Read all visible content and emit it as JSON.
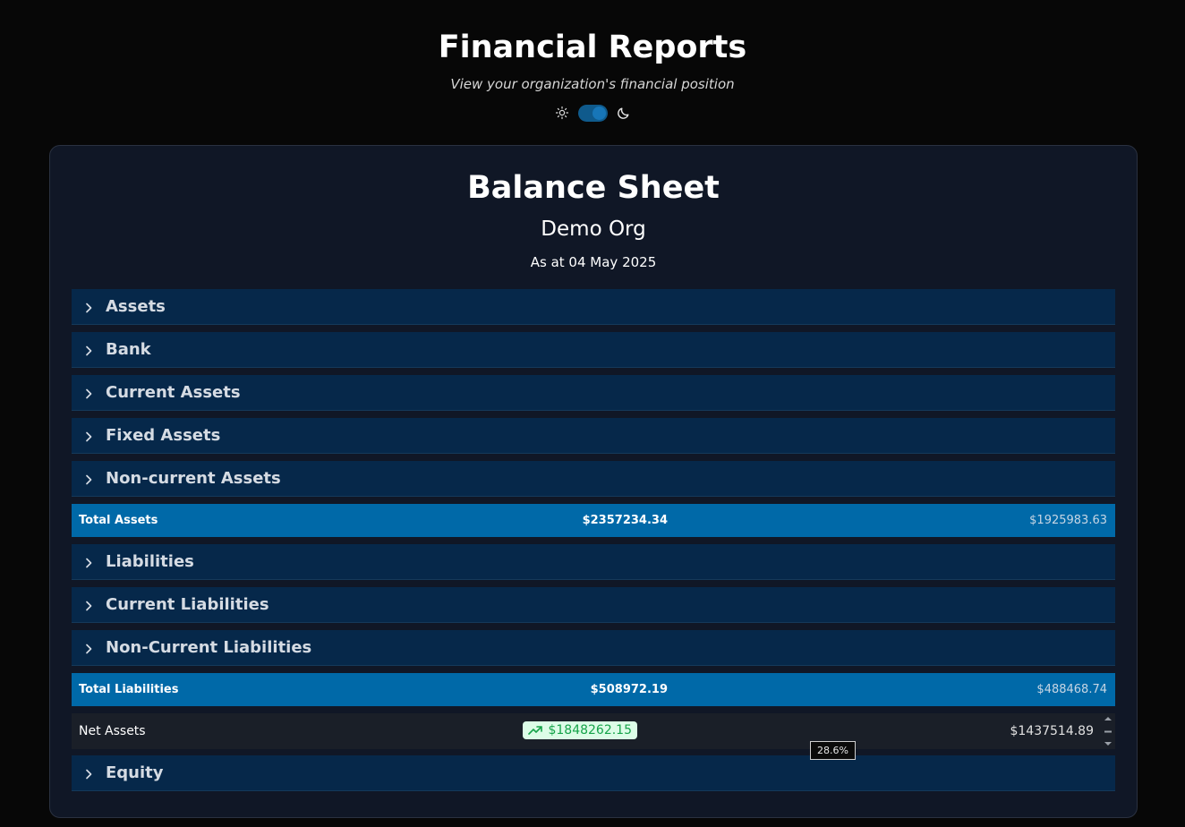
{
  "header": {
    "title": "Financial Reports",
    "subtitle": "View your organization's financial position"
  },
  "theme": {
    "light_icon": "sun-icon",
    "dark_icon": "moon-icon",
    "mode": "dark"
  },
  "report": {
    "title": "Balance Sheet",
    "org": "Demo Org",
    "date": "As at 04 May 2025"
  },
  "sections": {
    "assets": "Assets",
    "bank": "Bank",
    "current_assets": "Current Assets",
    "fixed_assets": "Fixed Assets",
    "noncurrent_assets": "Non-current Assets",
    "liabilities": "Liabilities",
    "current_liabilities": "Current Liabilities",
    "noncurrent_liabilities": "Non-Current Liabilities",
    "equity": "Equity"
  },
  "totals": {
    "assets": {
      "label": "Total Assets",
      "current": "$2357234.34",
      "previous": "$1925983.63"
    },
    "liabilities": {
      "label": "Total Liabilities",
      "current": "$508972.19",
      "previous": "$488468.74"
    }
  },
  "net_assets": {
    "label": "Net Assets",
    "current": "$1848262.15",
    "previous": "$1437514.89",
    "change": "28.6%",
    "trend_icon": "trending-up-icon"
  },
  "colors": {
    "background": "#070707",
    "card": "#101726",
    "section_row": "#06284a",
    "total_row": "#0069a8",
    "positive": "#16a34a"
  }
}
